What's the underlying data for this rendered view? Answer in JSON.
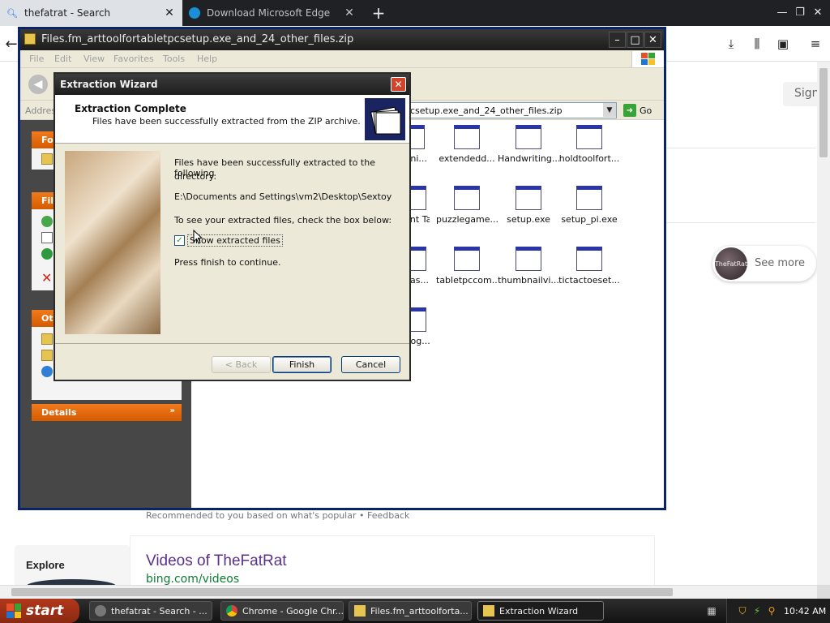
{
  "browser": {
    "tabs": [
      {
        "title": "thefatrat - Search",
        "icon": "search-icon"
      },
      {
        "title": "Download Microsoft Edge",
        "icon": "edge-icon"
      }
    ]
  },
  "background_page": {
    "signin": "Sign",
    "see_more": "See more",
    "avatar_text": "TheFatRat",
    "recommended": "Recommended to you based on what's popular • Feedback",
    "videos_title": "Videos of TheFatRat",
    "videos_url": "bing.com/videos",
    "explore": "Explore"
  },
  "explorer": {
    "title": "Files.fm_arttoolfortabletpcsetup.exe_and_24_other_files.zip",
    "menu": [
      "File",
      "Edit",
      "View",
      "Favorites",
      "Tools",
      "Help"
    ],
    "address_label": "Address",
    "address_value": "csetup.exe_and_24_other_files.zip",
    "go_label": "Go",
    "task_headers": [
      "Fol",
      "File",
      "Oth"
    ],
    "details_label": "Details",
    "files": [
      {
        "name": "...eni..."
      },
      {
        "name": "extendedd..."
      },
      {
        "name": "Handwriting..."
      },
      {
        "name": "holdtoolfort..."
      },
      {
        "name": "Paint Tab..."
      },
      {
        "name": "puzzlegame..."
      },
      {
        "name": "setup.exe"
      },
      {
        "name": "setup_pi.exe"
      },
      {
        "name": "...ras..."
      },
      {
        "name": "tabletpccom..."
      },
      {
        "name": "thumbnailvi..."
      },
      {
        "name": "tictactoeset..."
      },
      {
        "name": "...cog..."
      }
    ]
  },
  "wizard": {
    "title": "Extraction Wizard",
    "header_title": "Extraction Complete",
    "header_subtitle": "Files have been successfully extracted from the ZIP archive.",
    "body_line1": "Files have been successfully extracted to the following",
    "body_line1b": "directory:",
    "directory": "E:\\Documents and Settings\\vm2\\Desktop\\Sextoy",
    "body_line2": "To see your extracted files, check the box below:",
    "checkbox_label": "Show extracted files",
    "checkbox_checked": true,
    "body_line3": "Press finish to continue.",
    "back_label": "< Back",
    "finish_label": "Finish",
    "cancel_label": "Cancel"
  },
  "taskbar": {
    "start_label": "start",
    "buttons": [
      {
        "label": "thefatrat - Search - ...",
        "active": false
      },
      {
        "label": "Chrome - Google Chr...",
        "active": false
      },
      {
        "label": "Files.fm_arttoolforta...",
        "active": false
      },
      {
        "label": "Extraction Wizard",
        "active": true
      }
    ],
    "clock": "10:42 AM"
  }
}
